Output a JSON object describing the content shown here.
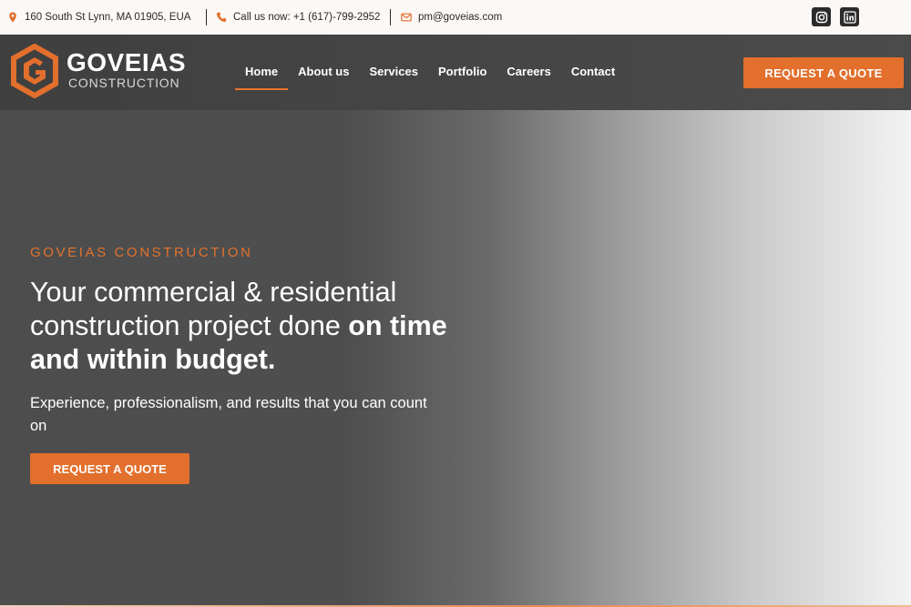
{
  "topbar": {
    "address": "160 South St Lynn, MA 01905, EUA",
    "phone": "Call us now: +1 (617)-799-2952",
    "email": "pm@goveias.com",
    "social": [
      {
        "icon": "instagram-icon"
      },
      {
        "icon": "linkedin-icon"
      }
    ]
  },
  "header": {
    "logo_name": "GOVEIAS",
    "logo_sub": "CONSTRUCTION",
    "nav": [
      "Home",
      "About us",
      "Services",
      "Portfolio",
      "Careers",
      "Contact"
    ],
    "active_nav": "Home",
    "cta": "REQUEST A QUOTE"
  },
  "hero": {
    "eyebrow": "GOVEIAS CONSTRUCTION",
    "headline_regular": "Your commercial & residential construction project done ",
    "headline_bold": "on time and within budget.",
    "subtext": "Experience, professionalism, and results that you can count on",
    "cta": "REQUEST A QUOTE"
  },
  "colors": {
    "accent": "#e26f2c",
    "header_bg": "#444444",
    "topbar_bg": "#fbf8f6"
  }
}
